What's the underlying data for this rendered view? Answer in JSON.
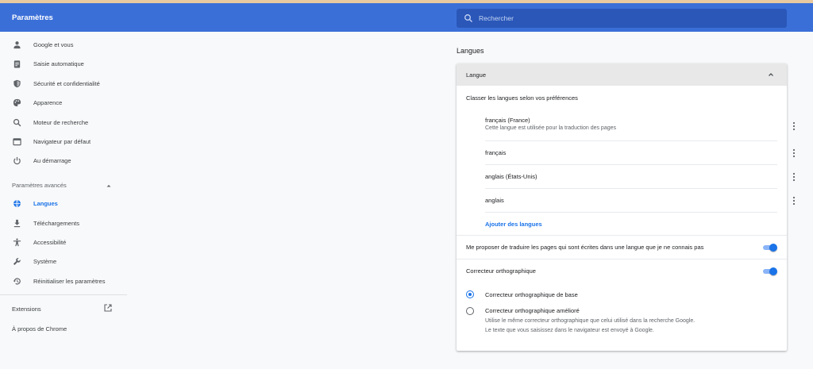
{
  "header": {
    "title": "Paramètres",
    "search_placeholder": "Rechercher"
  },
  "sidebar": {
    "items": [
      {
        "label": "Google et vous",
        "icon": "person-icon"
      },
      {
        "label": "Saisie automatique",
        "icon": "clipboard-icon"
      },
      {
        "label": "Sécurité et confidentialité",
        "icon": "shield-icon"
      },
      {
        "label": "Apparence",
        "icon": "palette-icon"
      },
      {
        "label": "Moteur de recherche",
        "icon": "search-icon"
      },
      {
        "label": "Navigateur par défaut",
        "icon": "browser-icon"
      },
      {
        "label": "Au démarrage",
        "icon": "power-icon"
      }
    ],
    "advanced_title": "Paramètres avancés",
    "advanced_items": [
      {
        "label": "Langues",
        "icon": "globe-icon",
        "active": true
      },
      {
        "label": "Téléchargements",
        "icon": "download-icon"
      },
      {
        "label": "Accessibilité",
        "icon": "accessibility-icon"
      },
      {
        "label": "Système",
        "icon": "wrench-icon"
      },
      {
        "label": "Réinitialiser les paramètres",
        "icon": "restore-icon"
      }
    ],
    "extensions": "Extensions",
    "about": "À propos de Chrome"
  },
  "main": {
    "section_title": "Langues",
    "card": {
      "header": "Langue",
      "order_label": "Classer les langues selon vos préférences",
      "languages": [
        {
          "name": "français (France)",
          "desc": "Cette langue est utilisée pour la traduction des pages"
        },
        {
          "name": "français",
          "desc": ""
        },
        {
          "name": "anglais (États-Unis)",
          "desc": ""
        },
        {
          "name": "anglais",
          "desc": ""
        }
      ],
      "add_languages": "Ajouter des langues",
      "translate_label": "Me proposer de traduire les pages qui sont écrites dans une langue que je ne connais pas",
      "translate_enabled": true,
      "spellcheck_label": "Correcteur orthographique",
      "spellcheck_enabled": true,
      "spell_basic": "Correcteur orthographique de base",
      "spell_enhanced": "Correcteur orthographique amélioré",
      "spell_enhanced_desc": "Utilise le même correcteur orthographique que celui utilisé dans la recherche Google. Le texte que vous saisissez dans le navigateur est envoyé à Google.",
      "selected_spell": "basic"
    }
  },
  "colors": {
    "header_bg": "#3b6fd8",
    "accent": "#1a73e8"
  }
}
